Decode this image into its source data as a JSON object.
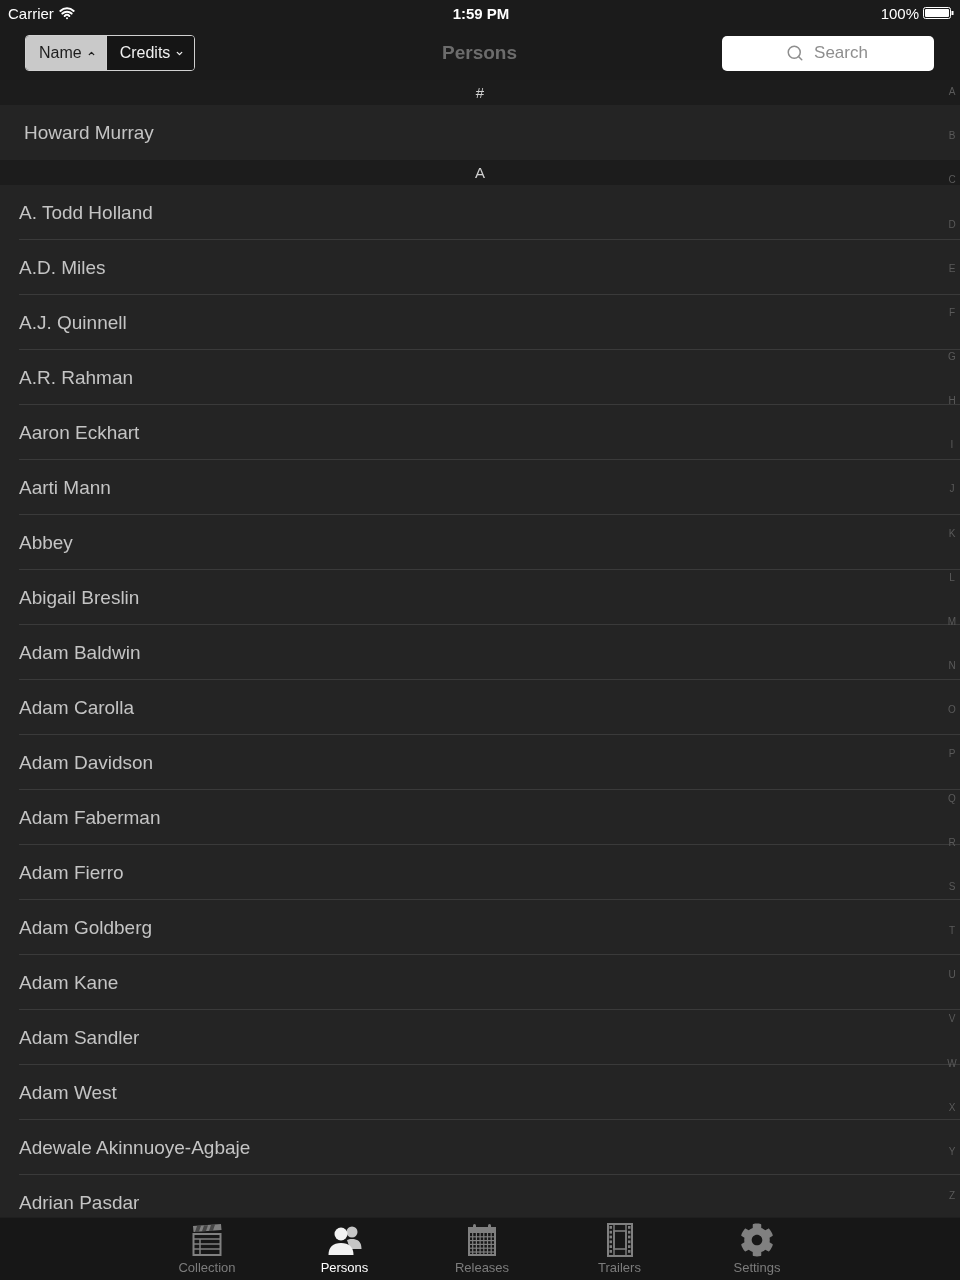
{
  "status_bar": {
    "carrier": "Carrier",
    "time": "1:59 PM",
    "battery": "100%"
  },
  "nav_bar": {
    "sort_segments": [
      {
        "label": "Name",
        "selected": true,
        "ascending": true
      },
      {
        "label": "Credits",
        "selected": false,
        "ascending": false
      }
    ],
    "title": "Persons",
    "search": {
      "placeholder": "Search"
    }
  },
  "sections": [
    {
      "header": "#",
      "rows": [
        "Howard Murray"
      ]
    },
    {
      "header": "A",
      "rows": [
        "A. Todd Holland",
        "A.D. Miles",
        "A.J. Quinnell",
        "A.R. Rahman",
        "Aaron Eckhart",
        "Aarti Mann",
        "Abbey",
        "Abigail Breslin",
        "Adam Baldwin",
        "Adam Carolla",
        "Adam Davidson",
        "Adam Faberman",
        "Adam Fierro",
        "Adam Goldberg",
        "Adam Kane",
        "Adam Sandler",
        "Adam West",
        "Adewale Akinnuoye-Agbaje",
        "Adrian Pasdar"
      ]
    }
  ],
  "index": [
    "A",
    "B",
    "C",
    "D",
    "E",
    "F",
    "G",
    "H",
    "I",
    "J",
    "K",
    "L",
    "M",
    "N",
    "O",
    "P",
    "Q",
    "R",
    "S",
    "T",
    "U",
    "V",
    "W",
    "X",
    "Y",
    "Z"
  ],
  "tab_bar": [
    {
      "label": "Collection",
      "selected": false
    },
    {
      "label": "Persons",
      "selected": true
    },
    {
      "label": "Releases",
      "selected": false
    },
    {
      "label": "Trailers",
      "selected": false
    },
    {
      "label": "Settings",
      "selected": false
    }
  ]
}
